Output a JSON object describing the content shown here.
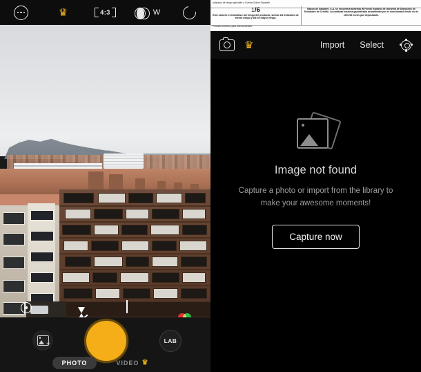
{
  "camera": {
    "topbar": {
      "more_label": "",
      "premium_label": "",
      "aspect_ratio": "4:3",
      "lens_label": "W",
      "flip_label": ""
    },
    "overlay": {
      "timer_label": "",
      "flash_label": "",
      "grid_label": "",
      "filters_label": ""
    },
    "bottom": {
      "gallery_label": "",
      "shutter_label": "",
      "lab_label": "LAB",
      "modes": [
        {
          "label": "PHOTO",
          "active": true,
          "badge": ""
        },
        {
          "label": "VIDEO",
          "active": false,
          "badge": "♛"
        }
      ]
    }
  },
  "banner": {
    "line_top": "Indicador de riesgo aplicable a Cuenta Online Sabadell",
    "risk_value": "1",
    "risk_total": "/6",
    "risk_desc": "Este número es indicativo del riesgo del producto, siendo 1/6 indicativo de menor riesgo y 6/6 de mayor riesgo.",
    "guarantee_text": "Banco de Sabadell, S.A. se encuentra adherido al Fondo Español de Garantía de Depósitos de Entidades de Crédito. La cantidad máxima garantizada actualmente por el mencionado fondo es de 100.000 euros por depositante.",
    "line_bottom": "Producto exclusivo para nuevos clientes."
  },
  "gallery": {
    "topbar": {
      "camera_label": "",
      "premium_label": "",
      "import_label": "Import",
      "select_label": "Select",
      "settings_label": ""
    },
    "empty_state": {
      "title": "Image not found",
      "description": "Capture a photo or import from the library to make your awesome moments!",
      "button_label": "Capture now"
    }
  },
  "colors": {
    "accent_gold": "#f5ae18",
    "crown_gold": "#f0b323",
    "panel_bg": "#000000",
    "text_primary": "#f2f2f2",
    "text_secondary": "#9c9c9c"
  }
}
